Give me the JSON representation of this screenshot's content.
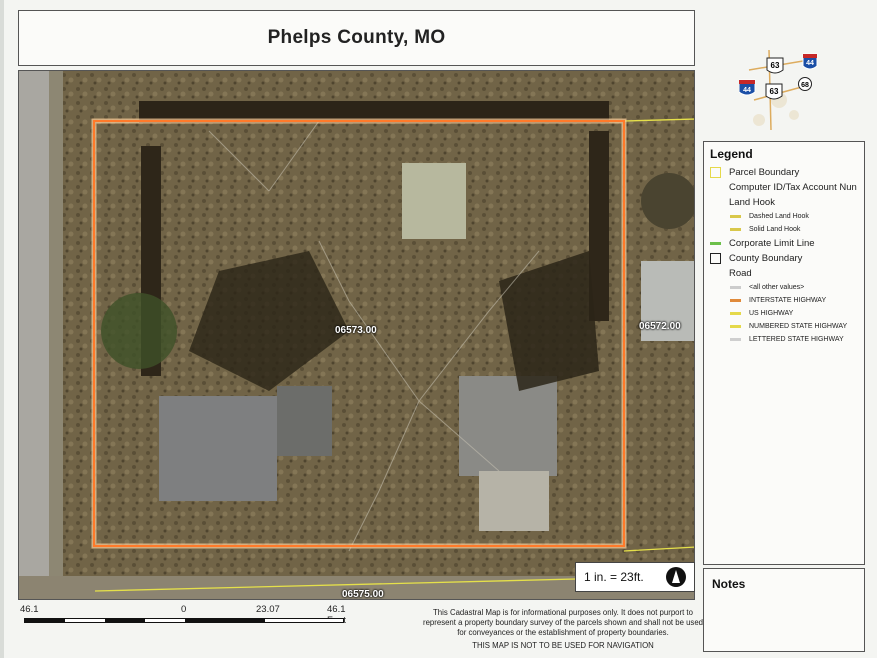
{
  "title": "Phelps County, MO",
  "map": {
    "parcels": [
      {
        "id": "06573.00",
        "subject": true
      },
      {
        "id": "06572.00",
        "subject": false
      },
      {
        "id": "06575.00",
        "subject": false
      }
    ],
    "scale_ratio": "1 in. = 23ft.",
    "north_arrow": "north-arrow-icon",
    "locator_shields": [
      "63",
      "44",
      "44",
      "63",
      "68"
    ]
  },
  "legend": {
    "title": "Legend",
    "items": [
      {
        "label": "Parcel Boundary",
        "swatch": "#e5d94a",
        "kind": "box"
      },
      {
        "label": "Computer ID/Tax Account Nun",
        "kind": "plain"
      },
      {
        "label": "Land Hook",
        "kind": "plain"
      },
      {
        "label": "Dashed Land Hook",
        "swatch": "#d9c84a",
        "kind": "sub"
      },
      {
        "label": "Solid Land Hook",
        "swatch": "#d9c84a",
        "kind": "sub"
      },
      {
        "label": "Corporate Limit Line",
        "swatch": "#6cc04a",
        "kind": "line"
      },
      {
        "label": "County Boundary",
        "swatch": "#222222",
        "kind": "box"
      },
      {
        "label": "Road",
        "kind": "plain"
      },
      {
        "label": "<all other values>",
        "swatch": "#cccccc",
        "kind": "sub"
      },
      {
        "label": "INTERSTATE HIGHWAY",
        "swatch": "#e08a3a",
        "kind": "sub"
      },
      {
        "label": "US HIGHWAY",
        "swatch": "#e5d94a",
        "kind": "sub"
      },
      {
        "label": "NUMBERED STATE HIGHWAY",
        "swatch": "#e5d94a",
        "kind": "sub"
      },
      {
        "label": "LETTERED STATE HIGHWAY",
        "swatch": "#cfcfcf",
        "kind": "sub"
      }
    ]
  },
  "notes": {
    "title": "Notes"
  },
  "scale_bar": {
    "left": "46.1",
    "zero": "0",
    "mid": "23.07",
    "right": "46.1 Feet"
  },
  "disclaimer": "This Cadastral Map is for informational purposes only.  It does not purport to represent a property boundary survey of the parcels shown and shall not be used for conveyances or the establishment of property boundaries.",
  "nav_warning": "THIS MAP IS NOT TO BE USED FOR NAVIGATION",
  "colors": {
    "subject_parcel": "#ff7a2a",
    "parcel_line": "#e5e04a"
  }
}
